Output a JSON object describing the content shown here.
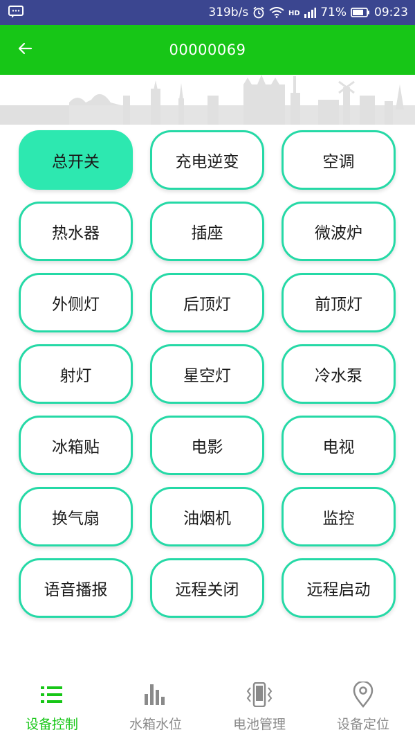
{
  "status_bar": {
    "speed": "319b/s",
    "battery_percent": "71%",
    "time": "09:23",
    "icons": [
      "message-icon",
      "alarm-icon",
      "wifi-icon",
      "hd-icon",
      "signal-icon",
      "battery-icon"
    ]
  },
  "header": {
    "title": "00000069",
    "back_icon": "arrow-left-icon",
    "background_color": "#17c617"
  },
  "controls": {
    "items": [
      {
        "label": "总开关",
        "active": true
      },
      {
        "label": "充电逆变",
        "active": false
      },
      {
        "label": "空调",
        "active": false
      },
      {
        "label": "热水器",
        "active": false
      },
      {
        "label": "插座",
        "active": false
      },
      {
        "label": "微波炉",
        "active": false
      },
      {
        "label": "外侧灯",
        "active": false
      },
      {
        "label": "后顶灯",
        "active": false
      },
      {
        "label": "前顶灯",
        "active": false
      },
      {
        "label": "射灯",
        "active": false
      },
      {
        "label": "星空灯",
        "active": false
      },
      {
        "label": "冷水泵",
        "active": false
      },
      {
        "label": "冰箱贴",
        "active": false
      },
      {
        "label": "电影",
        "active": false
      },
      {
        "label": "电视",
        "active": false
      },
      {
        "label": "换气扇",
        "active": false
      },
      {
        "label": "油烟机",
        "active": false
      },
      {
        "label": "监控",
        "active": false
      },
      {
        "label": "语音播报",
        "active": false
      },
      {
        "label": "远程关闭",
        "active": false
      },
      {
        "label": "远程启动",
        "active": false
      }
    ],
    "accent_color": "#25d9a6"
  },
  "bottom_nav": {
    "items": [
      {
        "label": "设备控制",
        "icon": "list-icon",
        "active": true
      },
      {
        "label": "水箱水位",
        "icon": "bar-levels-icon",
        "active": false
      },
      {
        "label": "电池管理",
        "icon": "phone-vibrate-icon",
        "active": false
      },
      {
        "label": "设备定位",
        "icon": "location-pin-icon",
        "active": false
      }
    ],
    "active_color": "#17c617",
    "inactive_color": "#8a8a8a"
  }
}
